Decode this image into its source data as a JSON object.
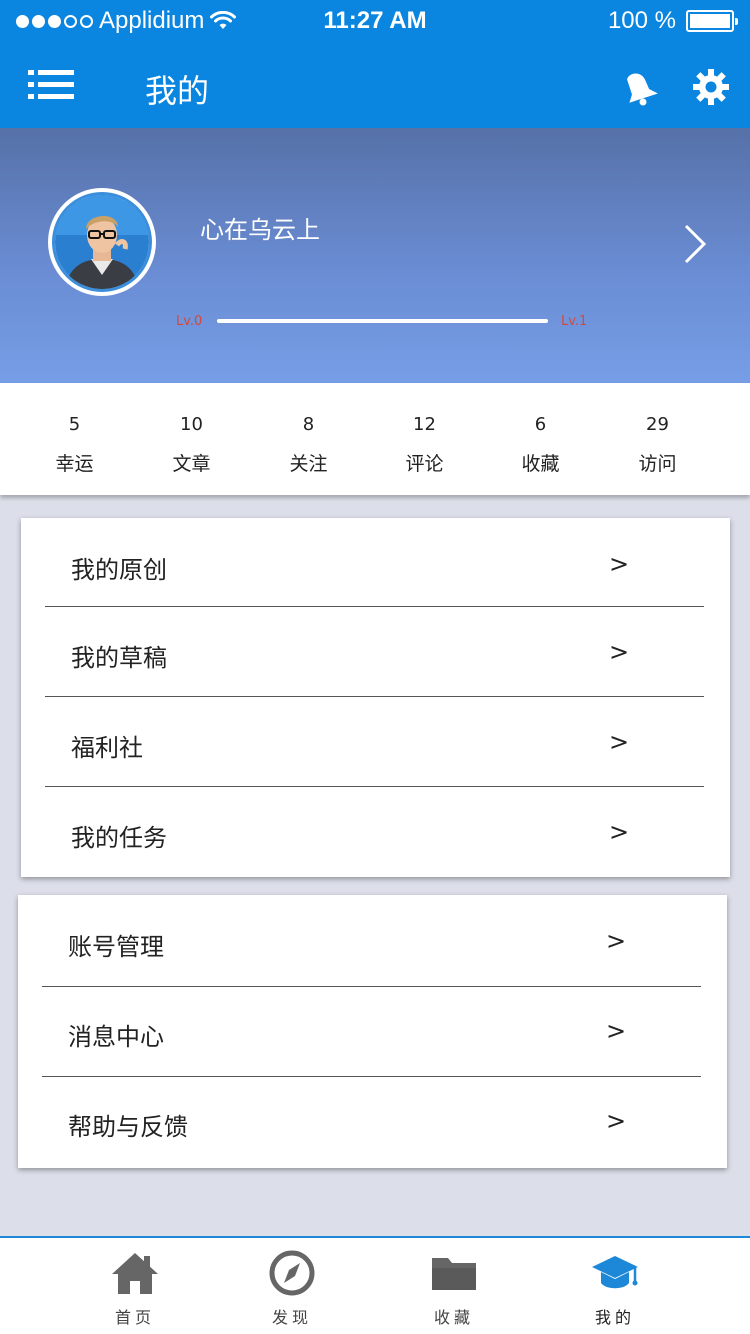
{
  "status_bar": {
    "carrier": "Applidium",
    "time": "11:27 AM",
    "battery": "100 %"
  },
  "navbar": {
    "title": "我的"
  },
  "profile": {
    "username": "心在乌云上",
    "level_current": "Lv.0",
    "level_next": "Lv.1",
    "level_progress": 1.0
  },
  "stats": [
    {
      "value": "5",
      "label": "幸运"
    },
    {
      "value": "10",
      "label": "文章"
    },
    {
      "value": "8",
      "label": "关注"
    },
    {
      "value": "12",
      "label": "评论"
    },
    {
      "value": "6",
      "label": "收藏"
    },
    {
      "value": "29",
      "label": "访问"
    }
  ],
  "menu_group_1": [
    {
      "label": "我的原创",
      "arrow": ">"
    },
    {
      "label": "我的草稿",
      "arrow": ">"
    },
    {
      "label": "福利社",
      "arrow": ">"
    },
    {
      "label": "我的任务",
      "arrow": ">"
    }
  ],
  "menu_group_2": [
    {
      "label": "账号管理",
      "arrow": ">"
    },
    {
      "label": "消息中心",
      "arrow": ">"
    },
    {
      "label": "帮助与反馈",
      "arrow": ">"
    }
  ],
  "tabbar": [
    {
      "label": "首页",
      "icon": "home-icon"
    },
    {
      "label": "发现",
      "icon": "compass-icon"
    },
    {
      "label": "收藏",
      "icon": "folder-icon"
    },
    {
      "label": "我的",
      "icon": "graduation-cap-icon"
    }
  ],
  "colors": {
    "primary": "#0a86e1",
    "active_tab": "#1e88d8",
    "inactive_tab": "#666666",
    "level_text": "#d24a3a"
  }
}
